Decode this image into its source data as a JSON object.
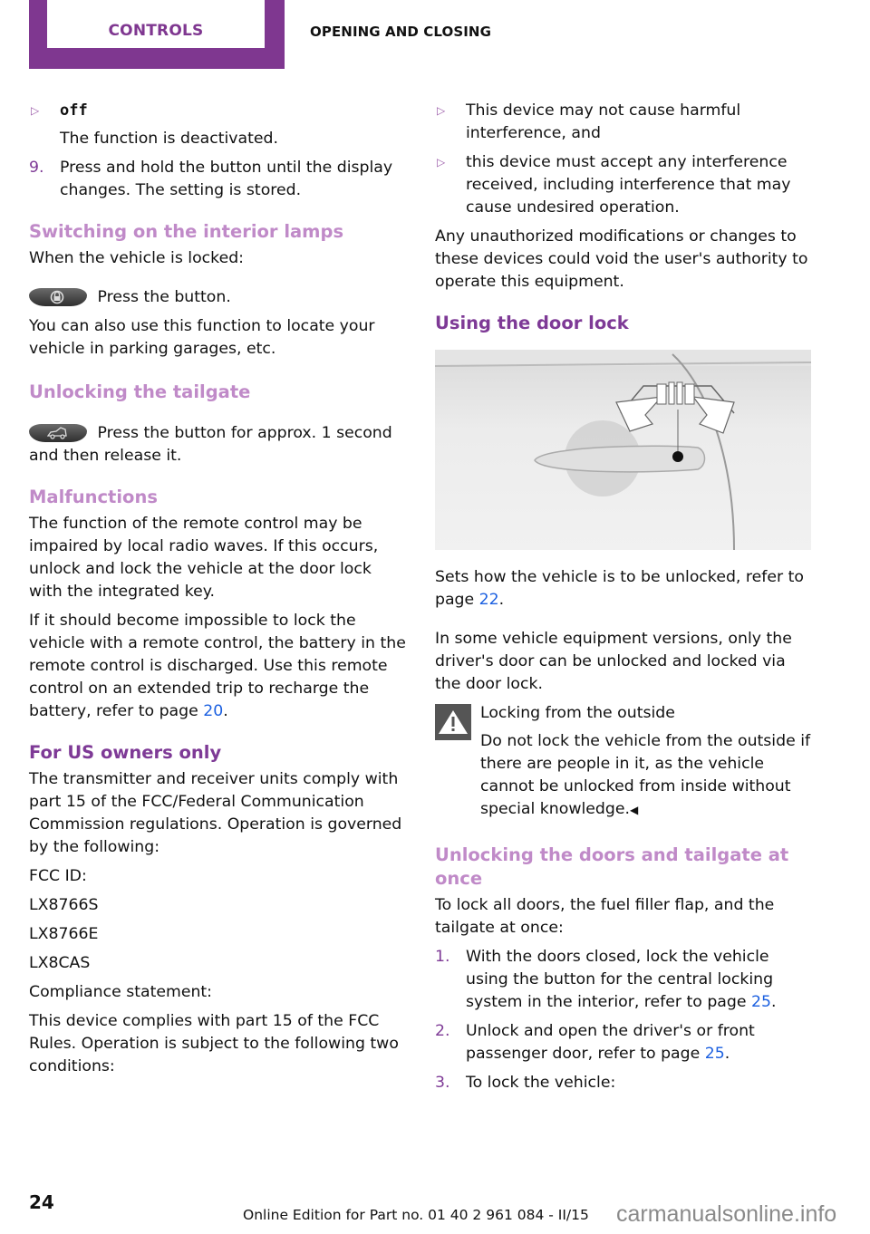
{
  "header": {
    "chapter_tab": "CONTROLS",
    "section": "OPENING AND CLOSING",
    "brand_color": "#7f3790"
  },
  "left": {
    "bullet_off_label": "off",
    "bullet_off_desc": "The function is deactivated.",
    "step9_num": "9.",
    "step9_text": "Press and hold the button until the display changes. The setting is stored.",
    "h_interior": "Switching on the interior lamps",
    "interior_intro": "When the vehicle is locked:",
    "interior_action": "Press the button.",
    "interior_note": "You can also use this function to locate your vehicle in parking garages, etc.",
    "h_tailgate": "Unlocking the tailgate",
    "tailgate_action": "Press the button for approx. 1 second and then release it.",
    "h_malfunctions": "Malfunctions",
    "malf_p1": "The function of the remote control may be impaired by local radio waves. If this occurs, unlock and lock the vehicle at the door lock with the integrated key.",
    "malf_p2_pre": "If it should become impossible to lock the vehicle with a remote control, the battery in the remote control is discharged. Use this remote control on an extended trip to recharge the battery, refer to page ",
    "malf_p2_link": "20",
    "malf_p2_post": ".",
    "h_us": "For US owners only",
    "us_p1": "The transmitter and receiver units comply with part 15 of the FCC/Federal Communication Commission regulations. Operation is governed by the following:",
    "fcc_label": "FCC ID:",
    "fcc_ids": [
      "LX8766S",
      "LX8766E",
      "LX8CAS"
    ],
    "compliance_label": "Compliance statement:",
    "compliance_text": "This device complies with part 15 of the FCC Rules. Operation is subject to the following two conditions:"
  },
  "right": {
    "cond1": "This device may not cause harmful interference, and",
    "cond2": "this device must accept any interference received, including interference that may cause undesired operation.",
    "unauth": "Any unauthorized modifications or changes to these devices could void the user's authority to operate this equipment.",
    "h_door": "Using the door lock",
    "door_p1_pre": "Sets how the vehicle is to be unlocked, refer to page ",
    "door_p1_link": "22",
    "door_p1_post": ".",
    "door_p2": "In some vehicle equipment versions, only the driver's door can be unlocked and locked via the door lock.",
    "warn_title": "Locking from the outside",
    "warn_text": "Do not lock the vehicle from the outside if there are people in it, as the vehicle cannot be unlocked from inside without special knowledge.",
    "warn_end": "◀",
    "h_once": "Unlocking the doors and tailgate at once",
    "once_intro": "To lock all doors, the fuel filler flap, and the tailgate at once:",
    "steps": [
      {
        "num": "1.",
        "pre": "With the doors closed, lock the vehicle using the button for the central locking system in the interior, refer to page ",
        "link": "25",
        "post": "."
      },
      {
        "num": "2.",
        "pre": "Unlock and open the driver's or front passenger door, refer to page ",
        "link": "25",
        "post": "."
      },
      {
        "num": "3.",
        "pre": "To lock the vehicle:",
        "link": "",
        "post": ""
      }
    ]
  },
  "footer": {
    "page_number": "24",
    "edition": "Online Edition for Part no. 01 40 2 961 084 - II/15",
    "watermark": "carmanualsonline.info"
  }
}
